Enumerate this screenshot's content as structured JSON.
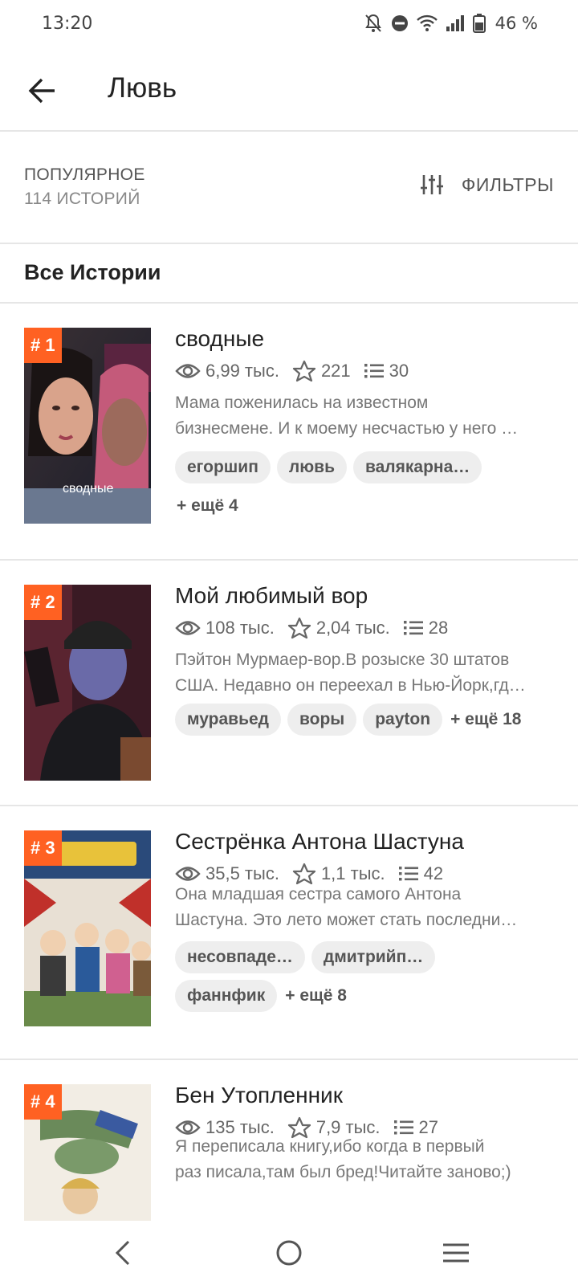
{
  "status_bar": {
    "time": "13:20",
    "battery": "46 %"
  },
  "header": {
    "title": "Лювь"
  },
  "sort": {
    "label": "ПОПУЛЯРНОЕ",
    "count": "114 ИСТОРИЙ",
    "filters_label": "ФИЛЬТРЫ"
  },
  "section": {
    "title": "Все Истории"
  },
  "stories": [
    {
      "rank": "# 1",
      "cover_caption": "сводные",
      "title": "сводные",
      "reads": "6,99 тыс.",
      "votes": "221",
      "parts": "30",
      "desc1": "Мама поженилась на известном",
      "desc2": "бизнесмене. И к моему несчастью у него …",
      "tags": [
        "егоршип",
        "лювь",
        "валякарна…"
      ],
      "more": "+ ещё 4"
    },
    {
      "rank": "# 2",
      "title": "Мой любимый вор",
      "reads": "108 тыс.",
      "votes": "2,04 тыс.",
      "parts": "28",
      "desc1": "Пэйтон Мурмаер-вор.В розыске 30 штатов",
      "desc2": "США. Недавно он переехал в Нью-Йорк,гд…",
      "tags": [
        "муравьед",
        "воры",
        "payton"
      ],
      "more": "+ ещё 18"
    },
    {
      "rank": "# 3",
      "title": "Сестрёнка Антона Шастуна",
      "reads": "35,5 тыс.",
      "votes": "1,1 тыс.",
      "parts": "42",
      "desc1": "Она младшая сестра самого Антона",
      "desc2": "Шастуна. Это лето может стать последни…",
      "tags": [
        "несовпаде…",
        "дмитрийп…",
        "фаннфик"
      ],
      "more": "+ ещё 8"
    },
    {
      "rank": "# 4",
      "title": "Бен Утопленник",
      "reads": "135 тыс.",
      "votes": "7,9 тыс.",
      "parts": "27",
      "desc1": "Я переписала книгу,ибо когда в первый",
      "desc2": "раз писала,там был бред!Читайте заново;)"
    }
  ],
  "colors": {
    "rank_badge": "#ff6122",
    "tag_bg": "#eeeeee",
    "divider": "#e6e6e6"
  }
}
